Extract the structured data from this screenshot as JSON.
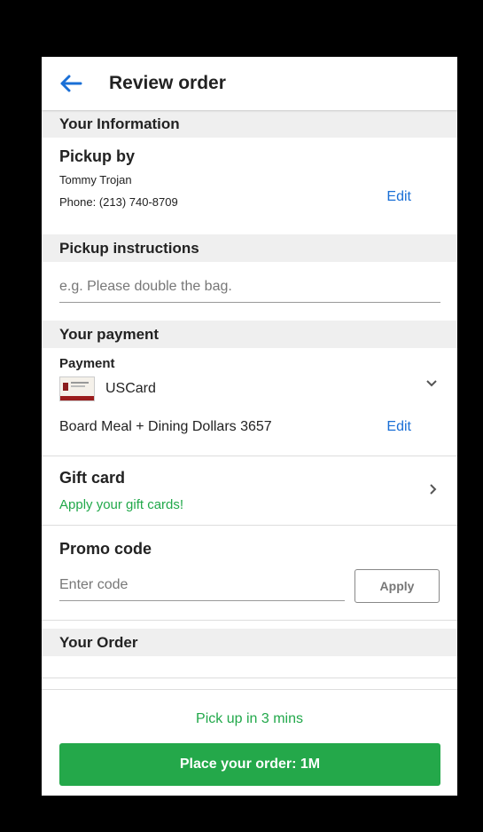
{
  "header": {
    "title": "Review order"
  },
  "info": {
    "section_title": "Your Information",
    "pickup_heading": "Pickup by",
    "name": "Tommy Trojan",
    "phone": "Phone: (213) 740-8709",
    "edit_label": "Edit"
  },
  "instructions": {
    "section_title": "Pickup instructions",
    "placeholder": "e.g. Please double the bag."
  },
  "payment": {
    "section_title": "Your payment",
    "heading": "Payment",
    "card_name": "USCard",
    "plan": "Board Meal + Dining Dollars 3657",
    "edit_label": "Edit"
  },
  "gift_card": {
    "heading": "Gift card",
    "subtext": "Apply your gift cards!"
  },
  "promo": {
    "heading": "Promo code",
    "placeholder": "Enter code",
    "apply_label": "Apply"
  },
  "order": {
    "section_title": "Your Order"
  },
  "footer": {
    "pickup_time": "Pick up in 3 mins",
    "place_order_label": "Place your order: 1M"
  },
  "colors": {
    "accent_blue": "#1a6fd6",
    "green": "#21a84a",
    "button_green": "#24a84a"
  }
}
